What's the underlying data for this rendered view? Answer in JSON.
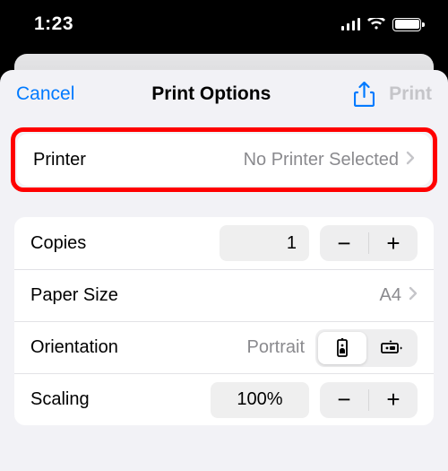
{
  "status": {
    "time": "1:23"
  },
  "nav": {
    "cancel": "Cancel",
    "title": "Print Options",
    "print": "Print"
  },
  "printer": {
    "label": "Printer",
    "value": "No Printer Selected"
  },
  "copies": {
    "label": "Copies",
    "value": "1"
  },
  "paper": {
    "label": "Paper Size",
    "value": "A4"
  },
  "orientation": {
    "label": "Orientation",
    "value": "Portrait"
  },
  "scaling": {
    "label": "Scaling",
    "value": "100%"
  }
}
